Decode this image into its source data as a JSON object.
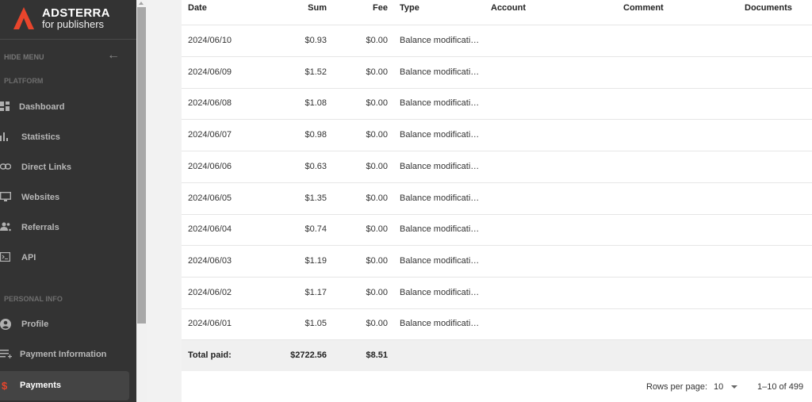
{
  "brand": {
    "title": "ADSTERRA",
    "subtitle": "for publishers",
    "accent": "#e8452c"
  },
  "sidebar": {
    "hide_menu": "HIDE MENU",
    "sections": [
      {
        "title": "PLATFORM",
        "items": [
          {
            "label": "Dashboard",
            "icon": "dashboard-icon"
          },
          {
            "label": "Statistics",
            "icon": "bar-chart-icon"
          },
          {
            "label": "Direct Links",
            "icon": "link-icon"
          },
          {
            "label": "Websites",
            "icon": "monitor-icon"
          },
          {
            "label": "Referrals",
            "icon": "people-icon"
          },
          {
            "label": "API",
            "icon": "terminal-icon"
          }
        ]
      },
      {
        "title": "PERSONAL INFO",
        "items": [
          {
            "label": "Profile",
            "icon": "account-circle-icon"
          },
          {
            "label": "Payment Information",
            "icon": "payment-add-icon"
          },
          {
            "label": "Payments",
            "icon": "dollar-icon",
            "active": true
          }
        ]
      }
    ]
  },
  "table": {
    "columns": [
      "Date",
      "Sum",
      "Fee",
      "Type",
      "Account",
      "Comment",
      "Documents"
    ],
    "rows": [
      {
        "date": "2024/06/10",
        "sum": "$0.93",
        "fee": "$0.00",
        "type": "Balance modificati…"
      },
      {
        "date": "2024/06/09",
        "sum": "$1.52",
        "fee": "$0.00",
        "type": "Balance modificati…"
      },
      {
        "date": "2024/06/08",
        "sum": "$1.08",
        "fee": "$0.00",
        "type": "Balance modificati…"
      },
      {
        "date": "2024/06/07",
        "sum": "$0.98",
        "fee": "$0.00",
        "type": "Balance modificati…"
      },
      {
        "date": "2024/06/06",
        "sum": "$0.63",
        "fee": "$0.00",
        "type": "Balance modificati…"
      },
      {
        "date": "2024/06/05",
        "sum": "$1.35",
        "fee": "$0.00",
        "type": "Balance modificati…"
      },
      {
        "date": "2024/06/04",
        "sum": "$0.74",
        "fee": "$0.00",
        "type": "Balance modificati…"
      },
      {
        "date": "2024/06/03",
        "sum": "$1.19",
        "fee": "$0.00",
        "type": "Balance modificati…"
      },
      {
        "date": "2024/06/02",
        "sum": "$1.17",
        "fee": "$0.00",
        "type": "Balance modificati…"
      },
      {
        "date": "2024/06/01",
        "sum": "$1.05",
        "fee": "$0.00",
        "type": "Balance modificati…"
      }
    ],
    "total": {
      "label": "Total paid:",
      "sum": "$2722.56",
      "fee": "$8.51"
    }
  },
  "pagination": {
    "rows_per_page_label": "Rows per page:",
    "rows_per_page": "10",
    "range": "1–10 of 499"
  }
}
